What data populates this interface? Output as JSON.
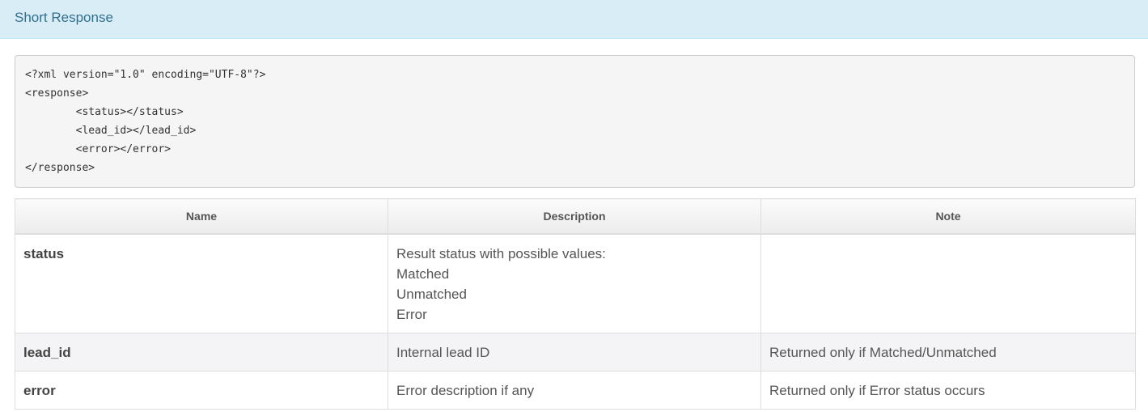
{
  "panel": {
    "title": "Short Response"
  },
  "code": {
    "lines": [
      "<?xml version=\"1.0\" encoding=\"UTF-8\"?>",
      "<response>",
      "        <status></status>",
      "        <lead_id></lead_id>",
      "        <error></error>",
      "</response>"
    ]
  },
  "table": {
    "headers": [
      "Name",
      "Description",
      "Note"
    ],
    "rows": [
      {
        "name": "status",
        "description": [
          "Result status with possible values:",
          "Matched",
          "Unmatched",
          "Error"
        ],
        "note": ""
      },
      {
        "name": "lead_id",
        "description": [
          "Internal lead ID"
        ],
        "note": "Returned only if Matched/Unmatched"
      },
      {
        "name": "error",
        "description": [
          "Error description if any"
        ],
        "note": "Returned only if Error status occurs"
      }
    ]
  },
  "colors": {
    "heading_bg": "#d9edf7",
    "heading_text": "#31708f",
    "code_bg": "#f5f5f5"
  }
}
